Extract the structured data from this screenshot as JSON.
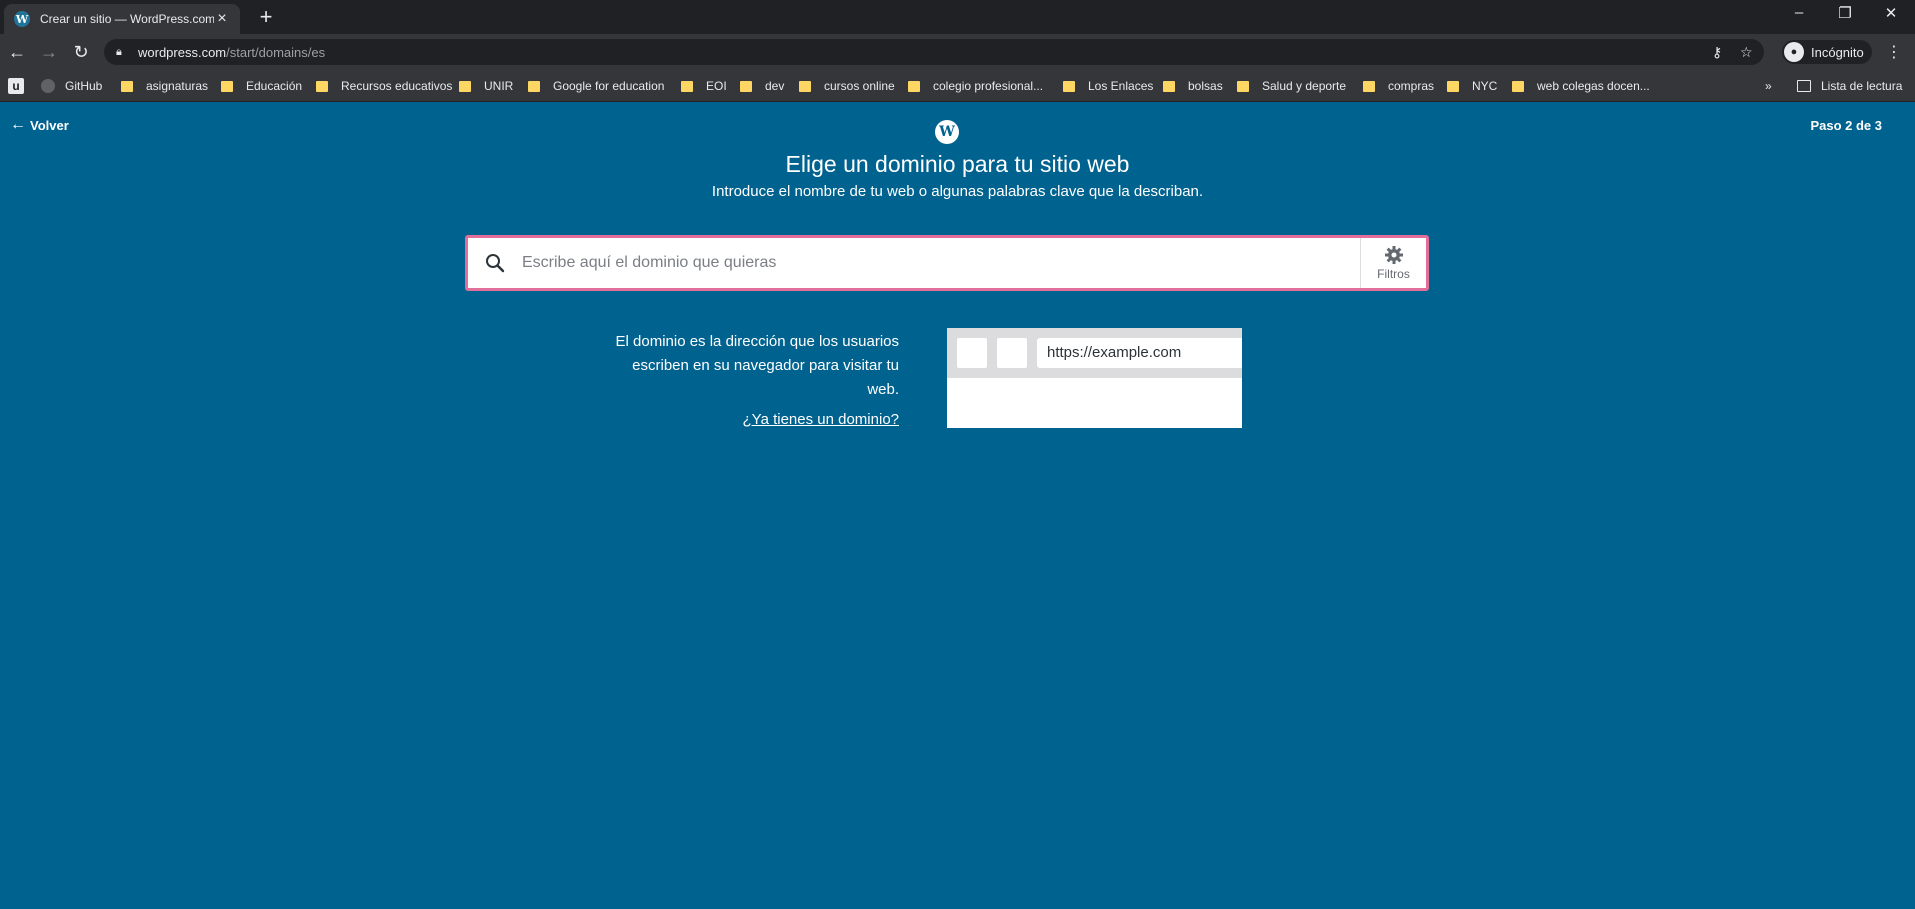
{
  "browser": {
    "tab_title": "Crear un sitio — WordPress.com",
    "url_host": "wordpress.com",
    "url_path": "/start/domains/es",
    "profile_label": "Incógnito",
    "bookmarks": [
      "GitHub",
      "asignaturas",
      "Educación",
      "Recursos educativos",
      "UNIR",
      "Google for education",
      "EOI",
      "dev",
      "cursos online",
      "colegio profesional...",
      "Los Enlaces",
      "bolsas",
      "Salud y deporte",
      "compras",
      "NYC",
      "web colegas docen..."
    ],
    "bookmarks_overflow": "»",
    "reading_list": "Lista de lectura"
  },
  "page": {
    "back_label": "Volver",
    "step_label": "Paso 2 de 3",
    "heading": "Elige un dominio para tu sitio web",
    "subheading": "Introduce el nombre de tu web o algunas palabras clave que la describan.",
    "search": {
      "placeholder": "Escribe aquí el dominio que quieras",
      "value": ""
    },
    "filters_label": "Filtros",
    "explain_text": "El dominio es la dirección que los usuarios escriben en su navegador para visitar tu web.",
    "have_domain_link": "¿Ya tienes un dominio?",
    "illustration_url": "https://example.com"
  },
  "colors": {
    "background": "#00628f",
    "search_border": "#e26f99",
    "folder": "#fdd663"
  }
}
